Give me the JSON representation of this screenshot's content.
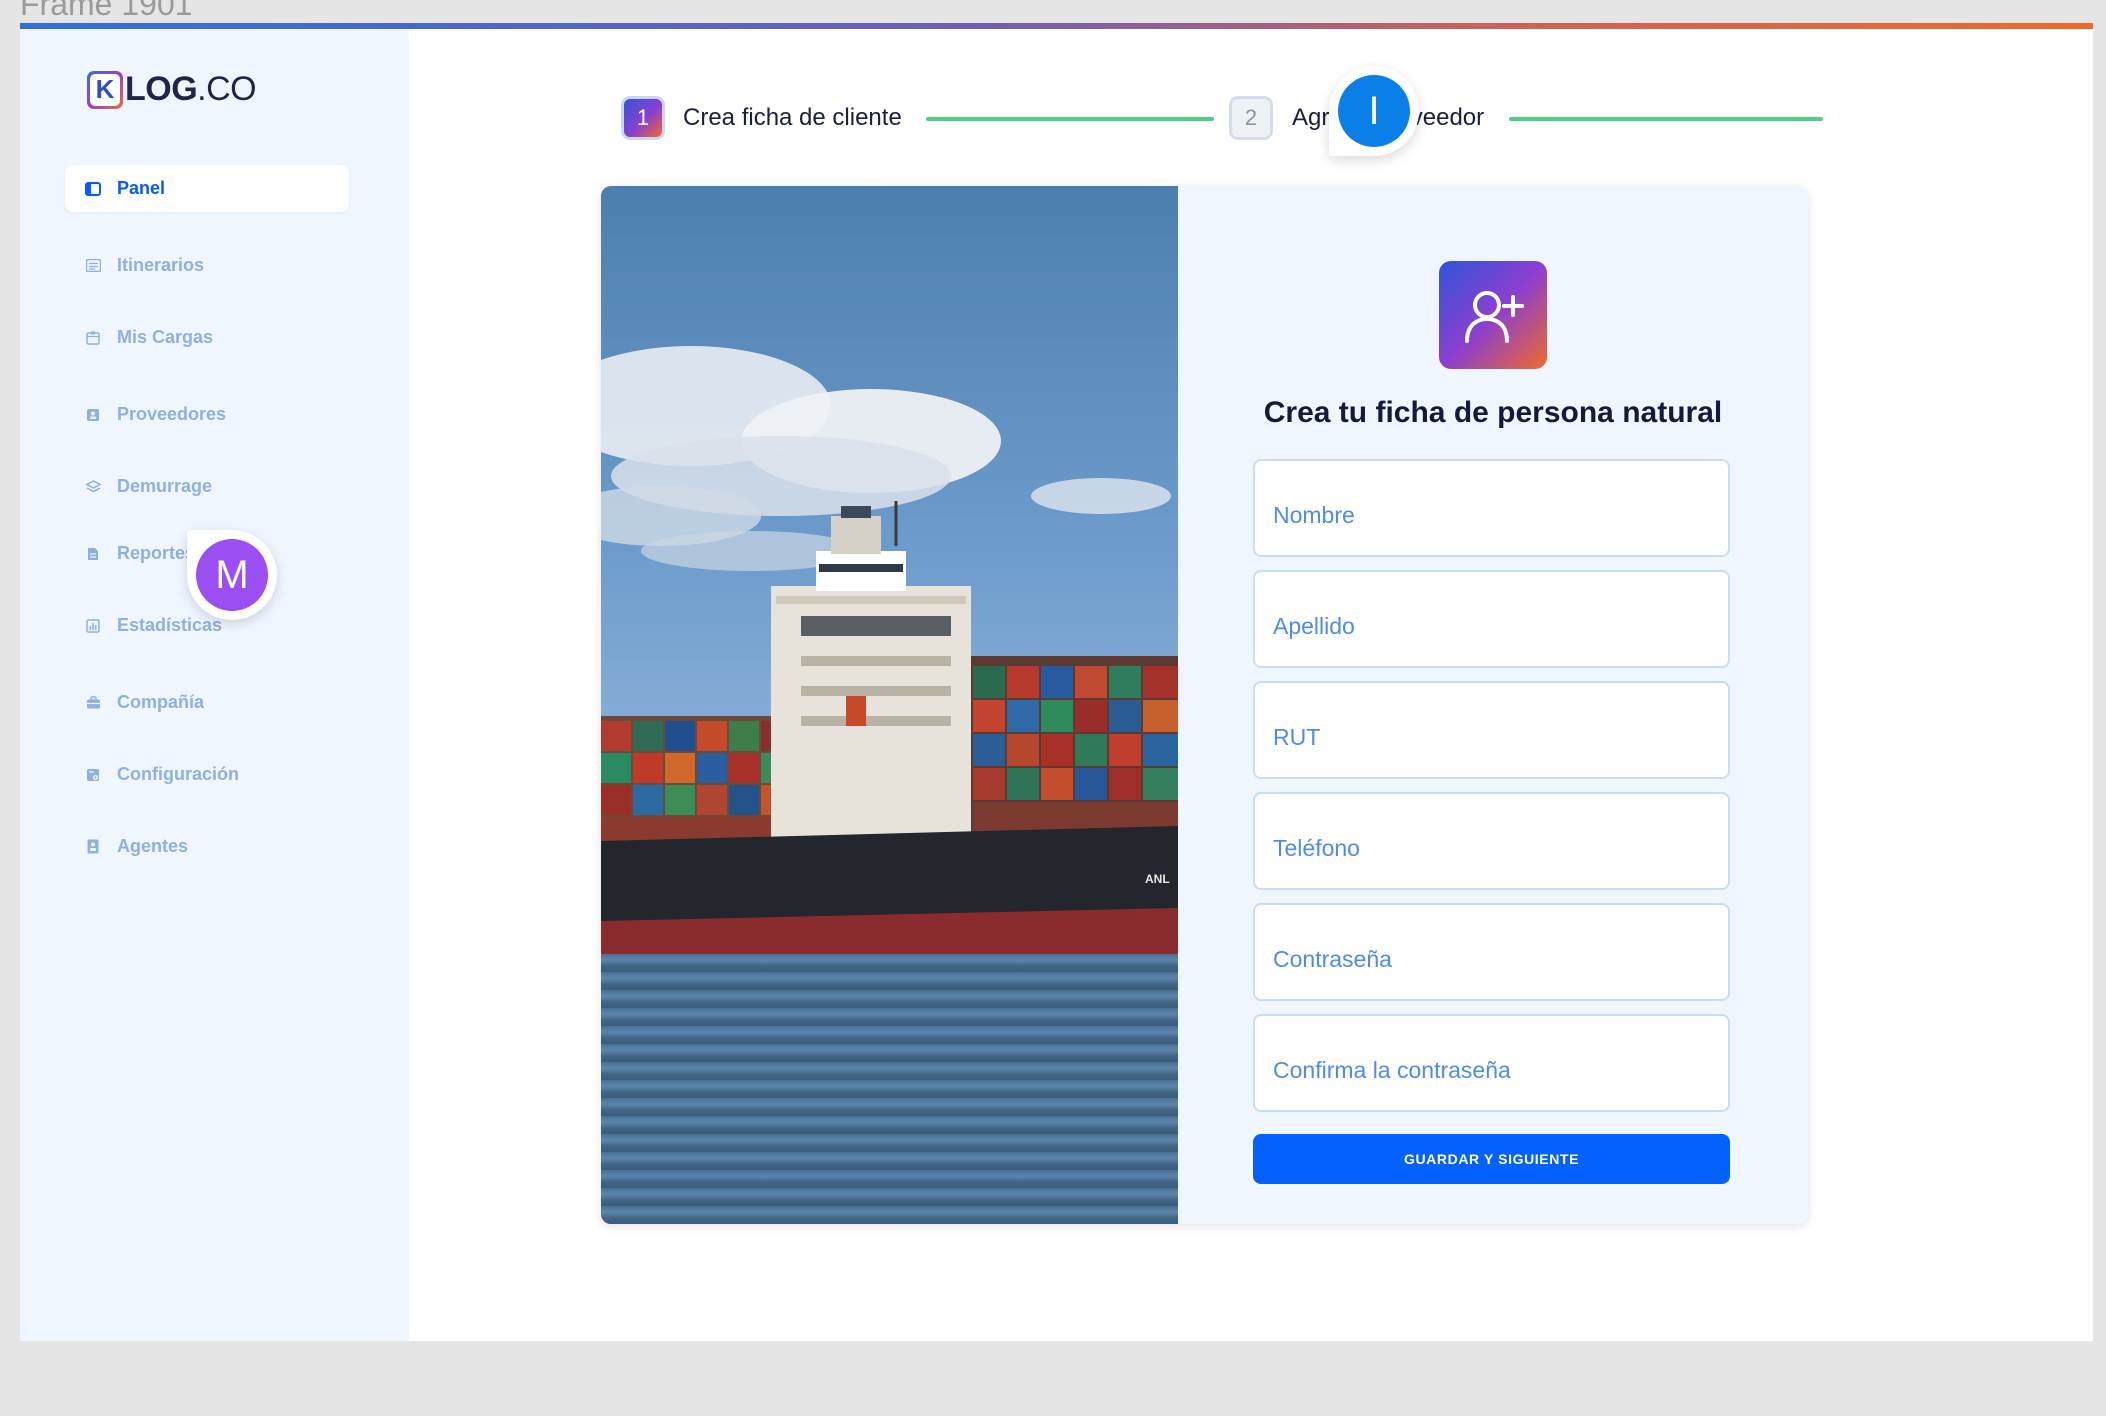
{
  "canvas": {
    "frame_label": "Frame 1901"
  },
  "brand": {
    "logo_letter": "K",
    "logo_text_bold": "LOG",
    "logo_text_rest": ".CO"
  },
  "sidebar": {
    "items": [
      {
        "label": "Panel",
        "icon": "panel-icon",
        "active": true
      },
      {
        "label": "Itinerarios",
        "icon": "itinerary-icon",
        "active": false
      },
      {
        "label": "Mis Cargas",
        "icon": "cargo-icon",
        "active": false
      },
      {
        "label": "Proveedores",
        "icon": "supplier-icon",
        "active": false
      },
      {
        "label": "Demurrage",
        "icon": "demurrage-icon",
        "active": false
      },
      {
        "label": "Reportes",
        "icon": "report-icon",
        "active": false
      },
      {
        "label": "Estadísticas",
        "icon": "stats-icon",
        "active": false
      },
      {
        "label": "Compañía",
        "icon": "company-icon",
        "active": false
      },
      {
        "label": "Configuración",
        "icon": "settings-icon",
        "active": false
      },
      {
        "label": "Agentes",
        "icon": "agents-icon",
        "active": false
      }
    ]
  },
  "stepper": {
    "steps": [
      {
        "number": "1",
        "label": "Crea ficha de cliente",
        "state": "active"
      },
      {
        "number": "2",
        "label": "Agrega proveedor",
        "state": "inactive"
      }
    ]
  },
  "collaborators": [
    {
      "initial": "M",
      "color": "#9b4ef2"
    },
    {
      "initial": "I",
      "color": "#0b7fe8"
    }
  ],
  "form": {
    "icon": "add-user-icon",
    "title": "Crea tu ficha de persona natural",
    "fields": [
      {
        "placeholder": "Nombre",
        "value": ""
      },
      {
        "placeholder": "Apellido",
        "value": ""
      },
      {
        "placeholder": "RUT",
        "value": ""
      },
      {
        "placeholder": "Teléfono",
        "value": ""
      },
      {
        "placeholder": "Contraseña",
        "value": ""
      },
      {
        "placeholder": "Confirma la contraseña",
        "value": ""
      }
    ],
    "submit_label": "GUARDAR Y SIGUIENTE"
  },
  "photo": {
    "hull_text": "ANL"
  },
  "colors": {
    "primary": "#0561fc",
    "accent_green": "#4fcf86",
    "sidebar_bg": "#f0f6ff"
  }
}
